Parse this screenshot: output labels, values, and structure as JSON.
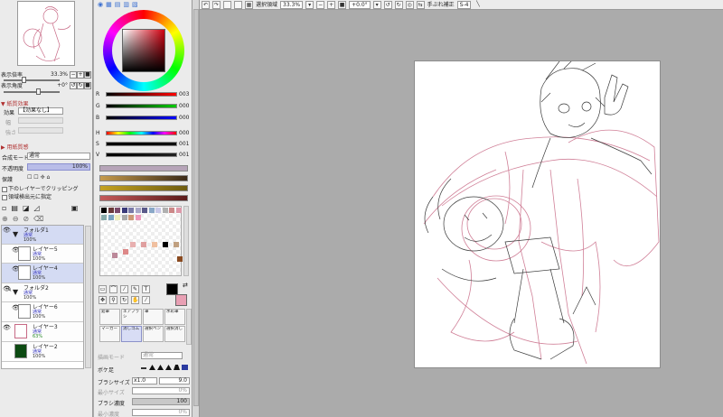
{
  "navigator": {
    "zoom_label": "表示倍率",
    "zoom_value": "33.3%",
    "angle_label": "表示角度",
    "angle_value": "+0°"
  },
  "effects": {
    "section": "紙質効果",
    "effect_label": "効果",
    "effect_value": "【効果なし】",
    "width_label": "幅",
    "strength_label": "強さ",
    "width_value": "",
    "strength_value": ""
  },
  "purpose": {
    "section": "用紙質感"
  },
  "layer_props": {
    "blend_label": "合成モード",
    "blend_value": "通常",
    "opacity_label": "不透明度",
    "opacity_value": "100%",
    "protect_label": "保護",
    "clip_label": "下のレイヤーでクリッピング",
    "select_label": "領域検出元に指定"
  },
  "layers": [
    {
      "name": "フォルダ1",
      "mode": "通常",
      "opacity": "100%"
    },
    {
      "name": "レイヤー5",
      "mode": "通常",
      "opacity": "100%"
    },
    {
      "name": "レイヤー4",
      "mode": "通常",
      "opacity": "100%"
    },
    {
      "name": "フォルダ2",
      "mode": "通常",
      "opacity": "100%"
    },
    {
      "name": "レイヤー6",
      "mode": "通常",
      "opacity": "100%"
    },
    {
      "name": "レイヤー3",
      "mode": "通常",
      "opacity": "63%"
    },
    {
      "name": "レイヤー2",
      "mode": "通常",
      "opacity": "100%"
    }
  ],
  "rgb": {
    "r": "003",
    "g": "000",
    "b": "000"
  },
  "hsv": {
    "h": "000",
    "s": "001",
    "v": "001"
  },
  "brushes": [
    {
      "name": "鉛筆"
    },
    {
      "name": "エアブラシ"
    },
    {
      "name": "筆"
    },
    {
      "name": "水彩筆"
    },
    {
      "name": "マーカー"
    },
    {
      "name": "消しゴム"
    },
    {
      "name": "選択ペン"
    },
    {
      "name": "選択消し"
    }
  ],
  "brush_props": {
    "mode_label": "描画モード",
    "mode_value": "通常",
    "edge_label": "ボケ足",
    "size_label": "ブラシサイズ",
    "size_mult": "x1.0",
    "size_value": "9.0",
    "min_label": "最小サイズ",
    "min_value": "0%",
    "density_label": "ブラシ濃度",
    "density_value": "100",
    "min_density_label": "最小濃度",
    "min_density_value": "0%"
  },
  "toolbar": {
    "select_label": "選択領域",
    "zoom": "33.3%",
    "angle": "+0.0°",
    "stab_label": "手ぶれ補正",
    "stab_value": "S-4"
  },
  "colors": {
    "primary": "#000000",
    "secondary": "#e8a0b4",
    "sketch": "#c86a86"
  }
}
